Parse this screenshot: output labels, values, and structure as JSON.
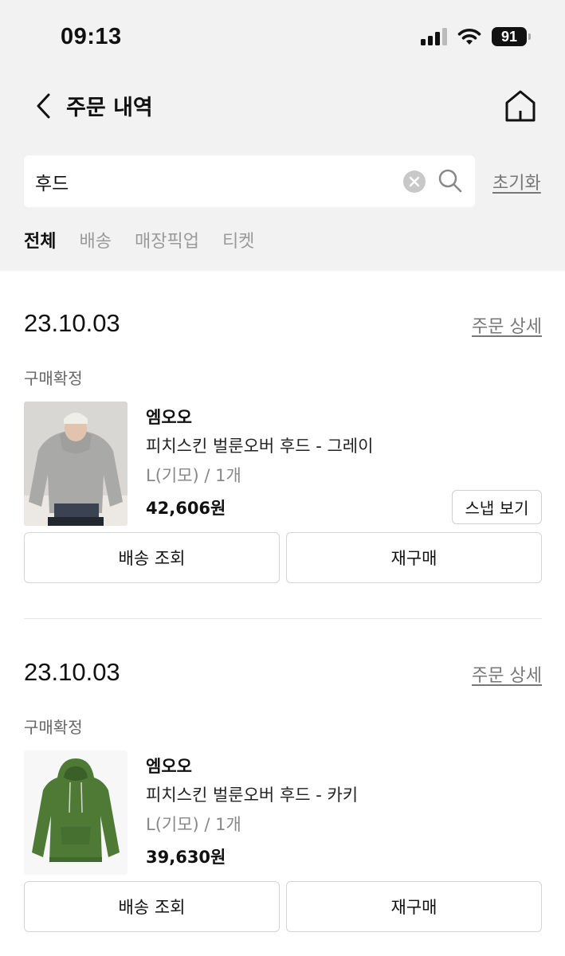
{
  "status_bar": {
    "time": "09:13",
    "battery": "91"
  },
  "header": {
    "title": "주문 내역"
  },
  "search": {
    "value": "후드",
    "reset_label": "초기화"
  },
  "tabs": [
    {
      "label": "전체",
      "active": true
    },
    {
      "label": "배송",
      "active": false
    },
    {
      "label": "매장픽업",
      "active": false
    },
    {
      "label": "티켓",
      "active": false
    }
  ],
  "orders": [
    {
      "date": "23.10.03",
      "detail_label": "주문 상세",
      "status": "구매확정",
      "brand": "엠오오",
      "product_name": "피치스킨 벌룬오버 후드 - 그레이",
      "option": "L(기모) / 1개",
      "price": "42,606원",
      "snap_label": "스냅 보기",
      "shipping_label": "배송 조회",
      "rebuy_label": "재구매"
    },
    {
      "date": "23.10.03",
      "detail_label": "주문 상세",
      "status": "구매확정",
      "brand": "엠오오",
      "product_name": "피치스킨 벌룬오버 후드 - 카키",
      "option": "L(기모) / 1개",
      "price": "39,630원",
      "shipping_label": "배송 조회",
      "rebuy_label": "재구매"
    }
  ],
  "colors": {
    "khaki_hoodie": "#4e7a36",
    "grey_hoodie": "#a9aaa8"
  }
}
